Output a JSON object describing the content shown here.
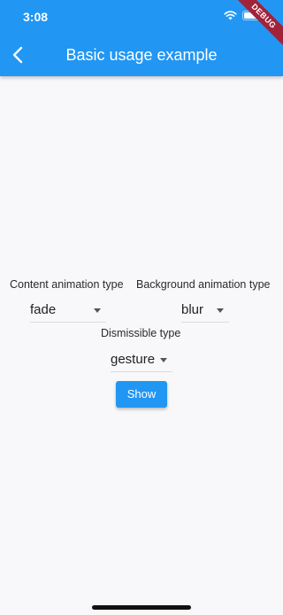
{
  "status_bar": {
    "time": "3:08",
    "icons": [
      "wifi-icon",
      "battery-icon"
    ]
  },
  "app_bar": {
    "title": "Basic usage example",
    "back_icon": "chevron-left-icon",
    "color": "#2196f3"
  },
  "debug_banner": {
    "label": "DEBUG",
    "color": "#a1233a"
  },
  "form": {
    "content_animation": {
      "label": "Content animation type",
      "value": "fade"
    },
    "background_animation": {
      "label": "Background animation type",
      "value": "blur"
    },
    "dismissible": {
      "label": "Dismissible type",
      "value": "gesture"
    },
    "show_button": {
      "label": "Show"
    }
  }
}
